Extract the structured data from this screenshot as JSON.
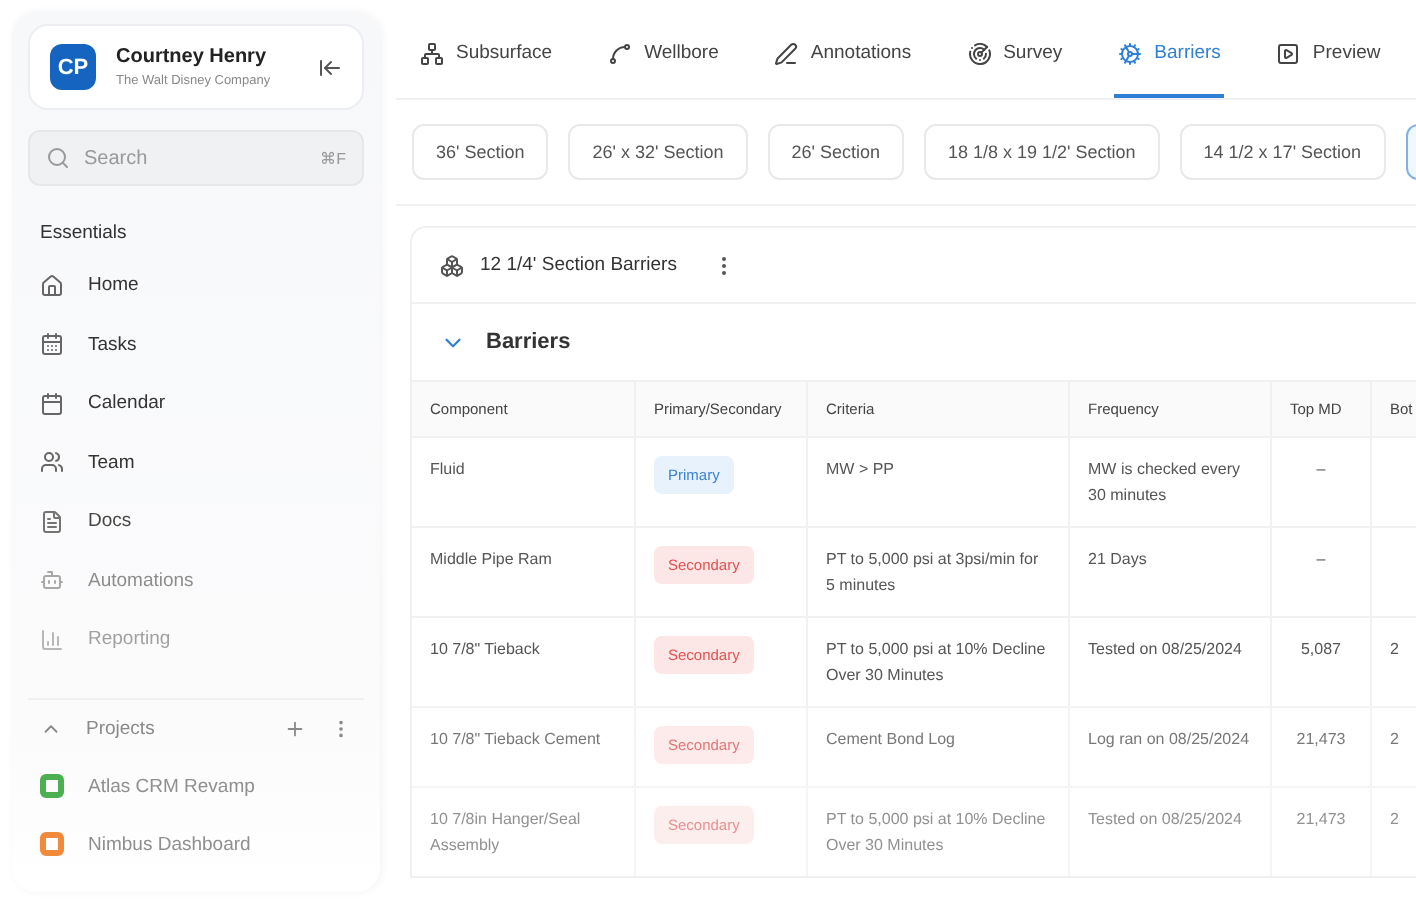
{
  "sidebar": {
    "user": {
      "initials": "CP",
      "name": "Courtney Henry",
      "company": "The Walt Disney Company"
    },
    "search": {
      "placeholder": "Search",
      "shortcut": "⌘F"
    },
    "section_title": "Essentials",
    "items": [
      {
        "label": "Home",
        "kind": "home"
      },
      {
        "label": "Tasks",
        "kind": "tasks"
      },
      {
        "label": "Calendar",
        "kind": "calendar"
      },
      {
        "label": "Team",
        "kind": "team"
      },
      {
        "label": "Docs",
        "kind": "docs"
      },
      {
        "label": "Automations",
        "kind": "automations"
      },
      {
        "label": "Reporting",
        "kind": "reporting"
      }
    ],
    "projects": {
      "title": "Projects",
      "expanded": true,
      "items": [
        {
          "label": "Atlas CRM Revamp",
          "color": "#4caf50"
        },
        {
          "label": "Nimbus Dashboard",
          "color": "#f28a3c"
        }
      ]
    }
  },
  "tabs": [
    {
      "label": "Subsurface",
      "kind": "subsurface",
      "selected": false
    },
    {
      "label": "Wellbore",
      "kind": "wellbore",
      "selected": false
    },
    {
      "label": "Annotations",
      "kind": "annotations",
      "selected": false
    },
    {
      "label": "Survey",
      "kind": "survey",
      "selected": false
    },
    {
      "label": "Barriers",
      "kind": "barriers",
      "selected": true
    },
    {
      "label": "Preview",
      "kind": "preview",
      "selected": false
    }
  ],
  "sections": [
    {
      "label": "36' Section",
      "selected": false
    },
    {
      "label": "26' x 32' Section",
      "selected": false
    },
    {
      "label": "26' Section",
      "selected": false
    },
    {
      "label": "18 1/8 x 19 1/2' Section",
      "selected": false
    },
    {
      "label": "14 1/2 x 17' Section",
      "selected": false
    },
    {
      "selected": true
    }
  ],
  "panel": {
    "title": "12 1/4' Section Barriers",
    "group": {
      "title": "Barriers",
      "expanded": true
    },
    "table": {
      "columns": [
        "Component",
        "Primary/Secondary",
        "Criteria",
        "Frequency",
        "Top MD",
        "Bot"
      ],
      "rows": [
        {
          "component": "Fluid",
          "type": "Primary",
          "criteria": "MW > PP",
          "frequency": "MW is checked every 30 minutes",
          "top_md": "–"
        },
        {
          "component": "Middle Pipe Ram",
          "type": "Secondary",
          "criteria": "PT to 5,000 psi at 3psi/min for 5 minutes",
          "frequency": "21 Days",
          "top_md": "–"
        },
        {
          "component": "10 7/8\" Tieback",
          "type": "Secondary",
          "criteria": "PT to 5,000 psi at 10% Decline Over 30 Minutes",
          "frequency": "Tested on 08/25/2024",
          "top_md": "5,087",
          "column_6": "2"
        },
        {
          "component": "10 7/8\" Tieback Cement",
          "type": "Secondary",
          "criteria": "Cement Bond Log",
          "frequency": "Log ran on 08/25/2024",
          "top_md": "21,473",
          "column_6": "2"
        },
        {
          "component": "10 7/8in Hanger/Seal Assembly",
          "type": "Secondary",
          "criteria": "PT to 5,000 psi at 10% Decline Over 30 Minutes",
          "frequency": "Tested on 08/25/2024",
          "top_md": "21,473",
          "column_6": "2"
        }
      ]
    }
  }
}
